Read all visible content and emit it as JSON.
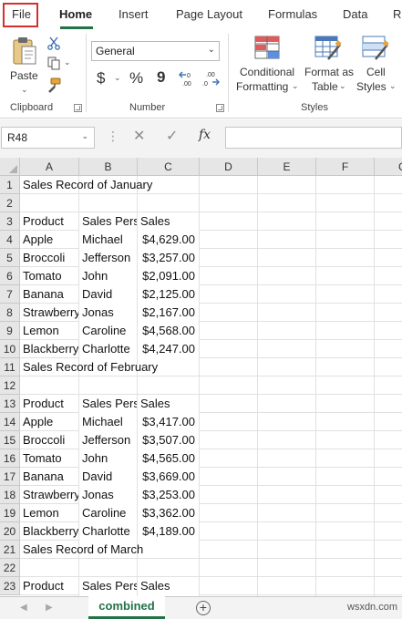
{
  "ribbon_tabs": [
    {
      "label": "File"
    },
    {
      "label": "Home"
    },
    {
      "label": "Insert"
    },
    {
      "label": "Page Layout"
    },
    {
      "label": "Formulas"
    },
    {
      "label": "Data"
    },
    {
      "label": "R"
    }
  ],
  "active_tab": "Home",
  "clipboard": {
    "paste_label": "Paste",
    "group_label": "Clipboard"
  },
  "number": {
    "format_value": "General",
    "dollar": "$",
    "percent": "%",
    "comma": "9",
    "group_label": "Number"
  },
  "styles": {
    "conditional_formatting_line1": "Conditional",
    "conditional_formatting_line2": "Formatting",
    "format_as_table_line1": "Format as",
    "format_as_table_line2": "Table",
    "cell_styles_line1": "Cell",
    "cell_styles_line2": "Styles",
    "group_label": "Styles"
  },
  "formula_bar": {
    "name_box": "R48",
    "fx": "fx",
    "formula": ""
  },
  "columns": [
    "A",
    "B",
    "C",
    "D",
    "E",
    "F",
    "G"
  ],
  "rows": [
    {
      "num": "1",
      "a": "Sales Record of January",
      "b": "",
      "c": ""
    },
    {
      "num": "2",
      "a": "",
      "b": "",
      "c": ""
    },
    {
      "num": "3",
      "a": "Product",
      "b": "Sales Person",
      "c": "Sales"
    },
    {
      "num": "4",
      "a": "Apple",
      "b": "Michael",
      "c": "$4,629.00"
    },
    {
      "num": "5",
      "a": "Broccoli",
      "b": "Jefferson",
      "c": "$3,257.00"
    },
    {
      "num": "6",
      "a": "Tomato",
      "b": "John",
      "c": "$2,091.00"
    },
    {
      "num": "7",
      "a": "Banana",
      "b": "David",
      "c": "$2,125.00"
    },
    {
      "num": "8",
      "a": "Strawberry",
      "b": "Jonas",
      "c": "$2,167.00"
    },
    {
      "num": "9",
      "a": "Lemon",
      "b": "Caroline",
      "c": "$4,568.00"
    },
    {
      "num": "10",
      "a": "Blackberry",
      "b": "Charlotte",
      "c": "$4,247.00"
    },
    {
      "num": "11",
      "a": "Sales Record of February",
      "b": "",
      "c": ""
    },
    {
      "num": "12",
      "a": "",
      "b": "",
      "c": ""
    },
    {
      "num": "13",
      "a": "Product",
      "b": "Sales Person",
      "c": "Sales"
    },
    {
      "num": "14",
      "a": "Apple",
      "b": "Michael",
      "c": "$3,417.00"
    },
    {
      "num": "15",
      "a": "Broccoli",
      "b": "Jefferson",
      "c": "$3,507.00"
    },
    {
      "num": "16",
      "a": "Tomato",
      "b": "John",
      "c": "$4,565.00"
    },
    {
      "num": "17",
      "a": "Banana",
      "b": "David",
      "c": "$3,669.00"
    },
    {
      "num": "18",
      "a": "Strawberry",
      "b": "Jonas",
      "c": "$3,253.00"
    },
    {
      "num": "19",
      "a": "Lemon",
      "b": "Caroline",
      "c": "$3,362.00"
    },
    {
      "num": "20",
      "a": "Blackberry",
      "b": "Charlotte",
      "c": "$4,189.00"
    },
    {
      "num": "21",
      "a": "Sales Record of March",
      "b": "",
      "c": ""
    },
    {
      "num": "22",
      "a": "",
      "b": "",
      "c": ""
    },
    {
      "num": "23",
      "a": "Product",
      "b": "Sales Person",
      "c": "Sales"
    }
  ],
  "sheet_tabs": [
    {
      "label": "combined",
      "active": true
    }
  ],
  "watermark": "wsxdn.com",
  "colors": {
    "accent": "#217346",
    "highlight_box": "#d32f2f",
    "header_bg": "#e6e6e6",
    "gridline": "#e1e1e1"
  }
}
